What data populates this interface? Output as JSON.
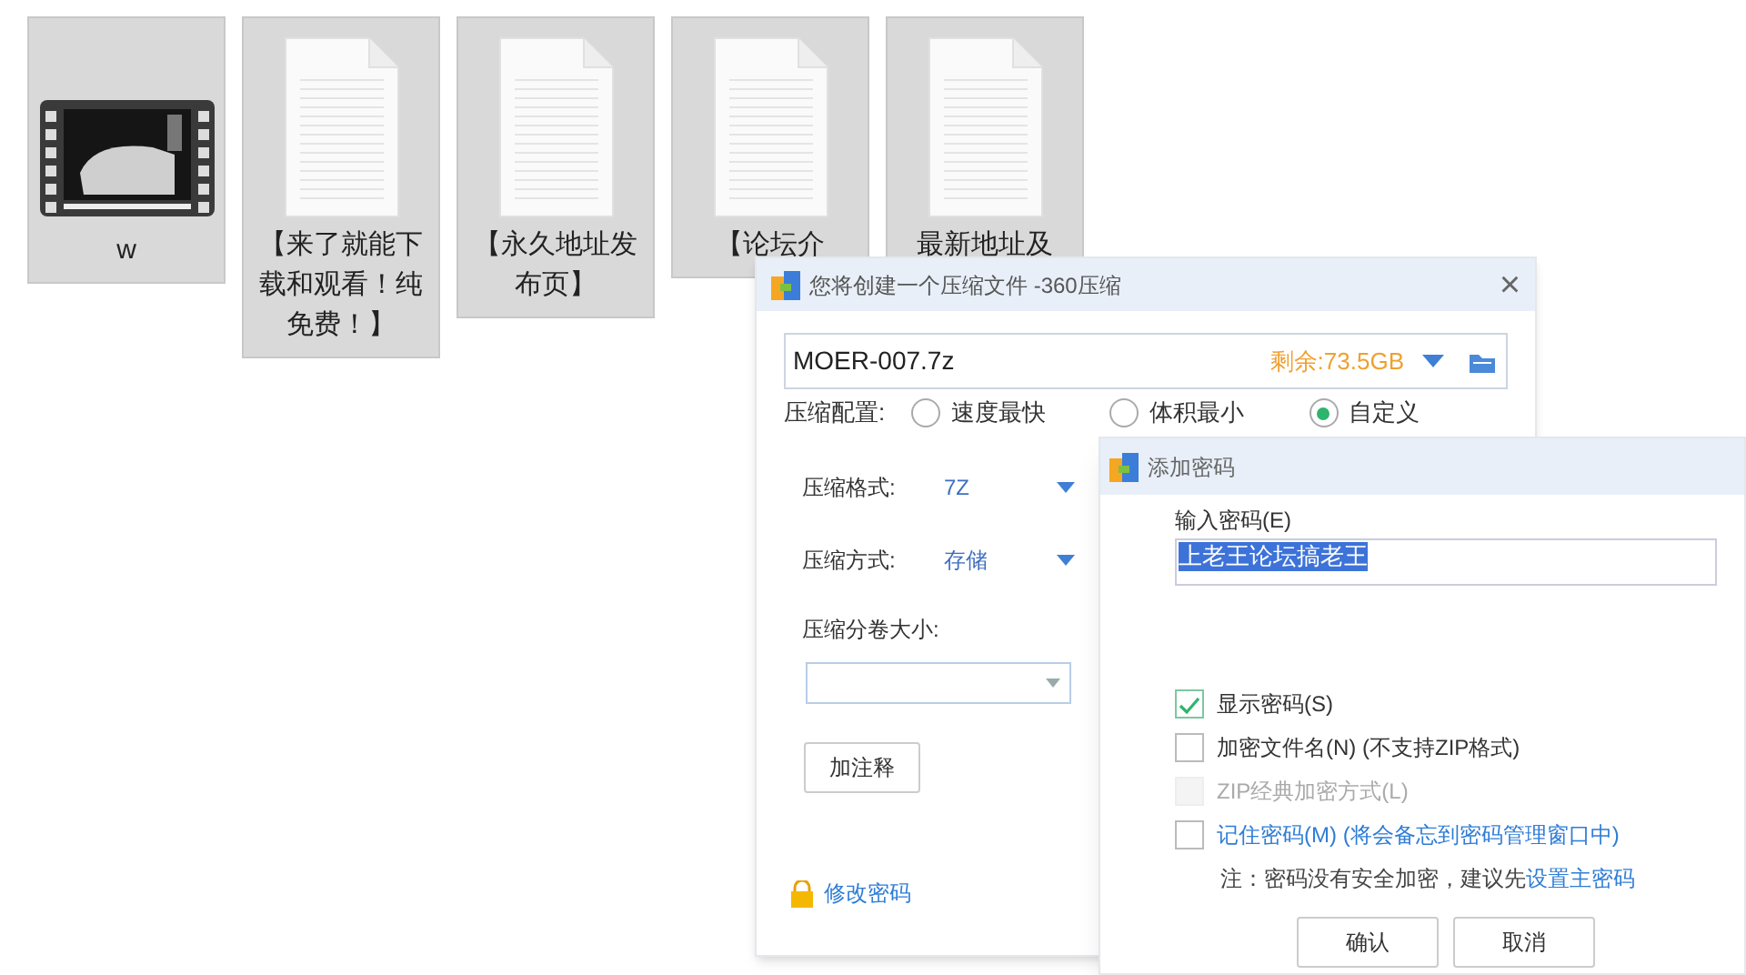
{
  "desktop_files": [
    {
      "kind": "video",
      "name": "w"
    },
    {
      "kind": "document",
      "name": "【来了就能下载和观看！纯免费！】"
    },
    {
      "kind": "document",
      "name": "【永久地址发布页】"
    },
    {
      "kind": "document",
      "name": "【论坛介"
    },
    {
      "kind": "document",
      "name": "最新地址及"
    }
  ],
  "compress_dialog": {
    "title": "您将创建一个压缩文件 -360压缩",
    "close": "×",
    "filename": "MOER-007.7z",
    "free_space": "剩余:73.5GB",
    "config_label": "压缩配置:",
    "presets": [
      {
        "label": "速度最快",
        "selected": false
      },
      {
        "label": "体积最小",
        "selected": false
      },
      {
        "label": "自定义",
        "selected": true
      }
    ],
    "format_label": "压缩格式:",
    "format": "7Z",
    "method_label": "压缩方式:",
    "method": "存储",
    "split_label": "压缩分卷大小:",
    "comment_button": "加注释",
    "change_password": "修改密码"
  },
  "password_dialog": {
    "title": "添加密码",
    "password_label": "输入密码(E)",
    "password": "上老王论坛搞老王",
    "options": [
      {
        "kind": "checkbox",
        "label": "显示密码(S)",
        "checked": true,
        "disabled": false
      },
      {
        "kind": "checkbox",
        "label": "加密文件名(N) (不支持ZIP格式)",
        "checked": false,
        "disabled": false
      },
      {
        "kind": "checkbox",
        "label": "ZIP经典加密方式(L)",
        "checked": false,
        "disabled": true
      },
      {
        "kind": "link",
        "label": "记住密码(M) (将会备忘到密码管理窗口中)",
        "checked": false,
        "disabled": false
      }
    ],
    "note": "注：密码没有安全加密，建议先",
    "note_link": "设置主密码",
    "buttons": [
      "确认",
      "取消"
    ]
  }
}
